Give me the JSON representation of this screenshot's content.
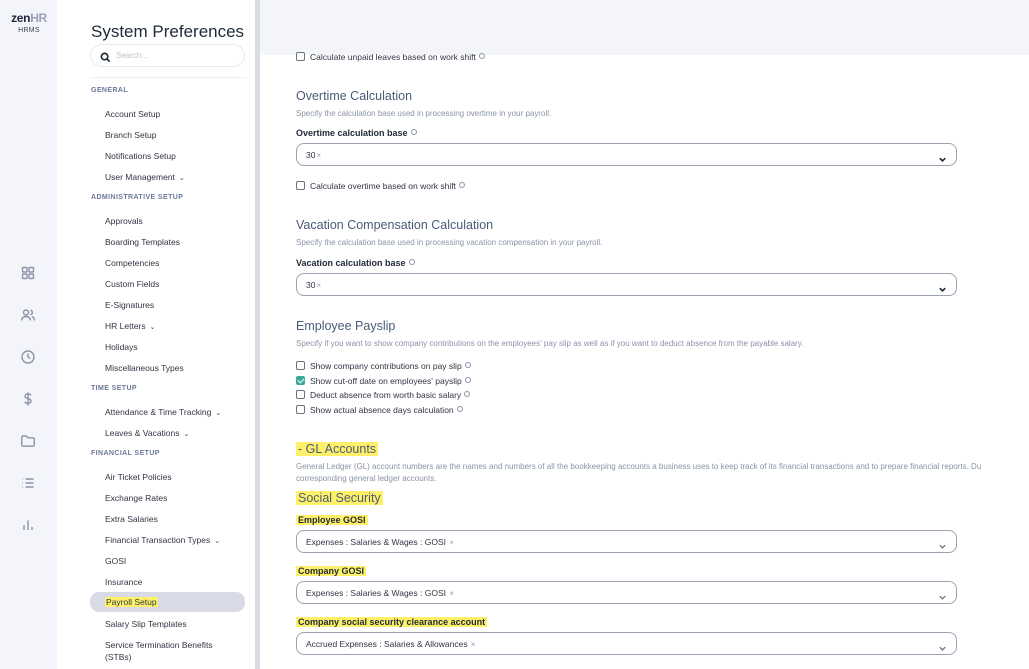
{
  "app": {
    "logo_main": "zen",
    "logo_accent": "HR",
    "logo_sub": "HRMS"
  },
  "rail_icons": [
    "grid-icon",
    "users-icon",
    "clock-icon",
    "dollar-icon",
    "folder-icon",
    "list-icon",
    "bar-chart-icon"
  ],
  "sidebar": {
    "title": "System Preferences",
    "search_placeholder": "Search...",
    "sections": {
      "general": "GENERAL",
      "administrative": "ADMINISTRATIVE SETUP",
      "time": "TIME SETUP",
      "financial": "FINANCIAL SETUP"
    },
    "items": {
      "account_setup": "Account Setup",
      "branch_setup": "Branch Setup",
      "notifications_setup": "Notifications Setup",
      "user_management": "User Management",
      "approvals": "Approvals",
      "boarding_templates": "Boarding Templates",
      "competencies": "Competencies",
      "custom_fields": "Custom Fields",
      "e_signatures": "E-Signatures",
      "hr_letters": "HR Letters",
      "holidays": "Holidays",
      "misc_types": "Miscellaneous Types",
      "attendance": "Attendance & Time Tracking",
      "leaves": "Leaves & Vacations",
      "air_ticket": "Air Ticket Policies",
      "exchange_rates": "Exchange Rates",
      "extra_salaries": "Extra Salaries",
      "financial_transaction_types": "Financial Transaction Types",
      "gosi": "GOSI",
      "insurance": "Insurance",
      "payroll_setup": "Payroll Setup",
      "salary_slip_templates": "Salary Slip Templates",
      "stb_line1": "Service Termination Benefits",
      "stb_line2": "(STBs)"
    }
  },
  "main": {
    "unpaid_leaves_checkbox": "Calculate unpaid leaves based on work shift",
    "overtime": {
      "title": "Overtime Calculation",
      "desc": "Specify the calculation base used in processing overtime in your payroll.",
      "base_label": "Overtime calculation base",
      "base_value": "30",
      "work_shift_checkbox": "Calculate overtime based on work shift"
    },
    "vacation": {
      "title": "Vacation Compensation Calculation",
      "desc": "Specify the calculation base used in processing vacation compensation in your payroll.",
      "base_label": "Vacation calculation base",
      "base_value": "30"
    },
    "payslip": {
      "title": "Employee Payslip",
      "desc": "Specify if you want to show company contributions on the employees' pay slip as well as if you want to deduct absence from the payable salary.",
      "options": {
        "company_contributions": "Show company contributions on pay slip",
        "cut_off_date": "Show cut-off date on employees' payslip",
        "deduct_absence": "Deduct absence from worth basic salary",
        "actual_absence": "Show actual absence days calculation"
      },
      "checked": {
        "company_contributions": false,
        "cut_off_date": true,
        "deduct_absence": false,
        "actual_absence": false
      }
    },
    "gl": {
      "title": "- GL Accounts",
      "desc_line1": "General Ledger (GL) account numbers are the names and numbers of all the bookkeeping accounts a business uses to keep track of its financial transactions and to prepare financial reports. Du",
      "desc_line2": "corresponding general ledger accounts."
    },
    "social_security": {
      "title": "Social Security",
      "employee_gosi_label": "Employee GOSI",
      "employee_gosi_value": "Expenses : Salaries & Wages : GOSI",
      "company_gosi_label": "Company GOSI",
      "company_gosi_value": "Expenses : Salaries & Wages : GOSI",
      "clearance_label": "Company social security clearance account",
      "clearance_value": "Accrued Expenses : Salaries & Allowances"
    }
  },
  "colors": {
    "highlight": "#fff06a",
    "checkbox_on": "#3aa89a",
    "section_title": "#4a5b78"
  }
}
